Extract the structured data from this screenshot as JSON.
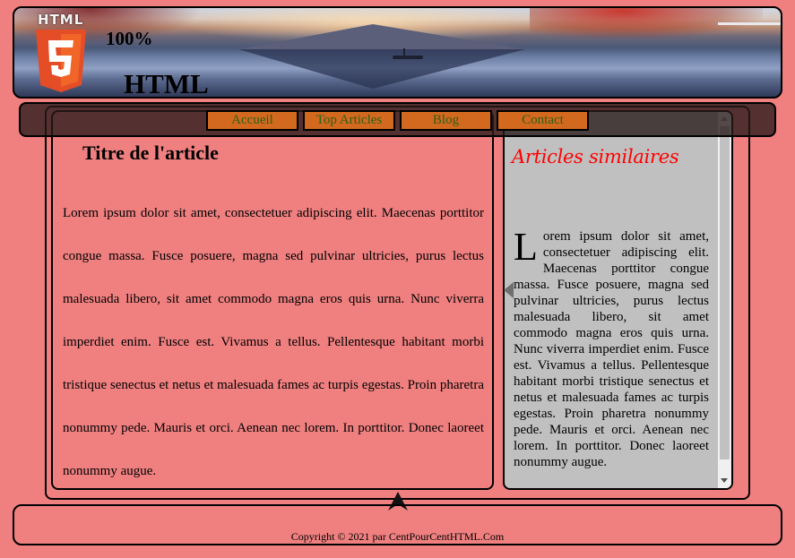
{
  "header": {
    "logo_word": "HTML",
    "percent": "100%",
    "site_title": "HTML"
  },
  "nav": {
    "items": [
      {
        "label": "Accueil"
      },
      {
        "label": "Top Articles"
      },
      {
        "label": "Blog"
      },
      {
        "label": "Contact"
      }
    ]
  },
  "article": {
    "title": "Titre de l'article",
    "body": "Lorem ipsum dolor sit amet, consectetuer adipiscing elit. Maecenas porttitor congue massa. Fusce posuere, magna sed pulvinar ultricies, purus lectus malesuada libero, sit amet commodo magna eros quis urna. Nunc viverra imperdiet enim. Fusce est. Vivamus a tellus. Pellentesque habitant morbi tristique senectus et netus et malesuada fames ac turpis egestas. Proin pharetra nonummy pede. Mauris et orci. Aenean nec lorem. In porttitor. Donec laoreet nonummy augue."
  },
  "aside": {
    "title": "Articles similaires",
    "dropcap": "L",
    "body": "orem ipsum dolor sit amet, consectetuer adipiscing elit. Maecenas porttitor congue massa. Fusce posuere, magna sed pulvinar ultricies, purus lectus malesuada libero, sit amet commodo magna eros quis urna. Nunc viverra imperdiet enim. Fusce est. Vivamus a tellus. Pellentesque habitant morbi tristique senectus et netus et malesuada fames ac turpis egestas. Proin pharetra nonummy pede. Mauris et orci. Aenean nec lorem. In porttitor. Donec laoreet nonummy augue."
  },
  "footer": {
    "copyright": "Copyright © 2021 par CentPourCentHTML.Com"
  },
  "colors": {
    "page_background": "#f08080",
    "nav_button": "#d2691e",
    "nav_text": "#2e5f16",
    "aside_background": "#c0c0c0",
    "aside_title": "#ff0000",
    "html5_orange": "#e44d26"
  },
  "icons": {
    "logo": "html5-shield-icon",
    "collapse": "triangle-left-icon",
    "back_to_top": "arrow-up-icon"
  }
}
